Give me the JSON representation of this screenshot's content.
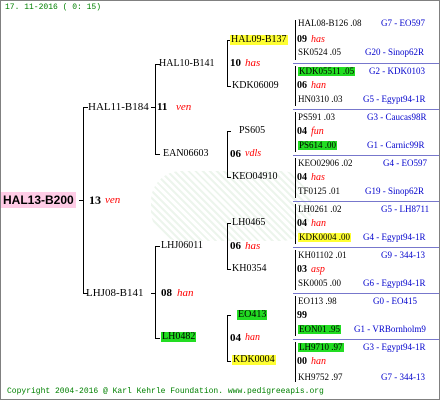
{
  "header": {
    "date": "17. 11-2016 (  0: 15)"
  },
  "footer": {
    "copyright": "Copyright 2004-2016 @ Karl Kehrle Foundation.   www.pedigreeapis.org"
  },
  "root": {
    "name": "HAL13-B200",
    "gen": "13",
    "breed": "ven"
  },
  "sire": {
    "name": "HAL11-B184",
    "gen": "11",
    "breed": "ven"
  },
  "dam": {
    "name": "LHJ08-B141",
    "gen": "08",
    "breed": "han"
  },
  "ss": {
    "name": "HAL10-B141",
    "gen": "10",
    "breed": "has"
  },
  "sd": {
    "name": "EAN06603",
    "gen": "06",
    "breed": "vdls"
  },
  "ds": {
    "name": "LHJ06011",
    "gen": "06",
    "breed": "has"
  },
  "dd": {
    "name": "LH0482",
    "gen": "04",
    "breed": "han"
  },
  "sss": {
    "name": "HAL09-B137",
    "gen": "09",
    "breed": "has"
  },
  "ssd": {
    "name": "KDK06009",
    "gen": "06",
    "breed": "han"
  },
  "sds": {
    "name": "PS605",
    "gen": "04",
    "breed": "fun"
  },
  "sdd": {
    "name": "KEO04910",
    "gen": "04",
    "breed": "has"
  },
  "dss": {
    "name": "LH0465",
    "gen": "04",
    "breed": "han"
  },
  "dsd": {
    "name": "KH0354",
    "gen": "03",
    "breed": "asp"
  },
  "dds": {
    "name": "EO413",
    "gen": "99",
    "breed": ""
  },
  "ddd": {
    "name": "KDK0004",
    "gen": "00",
    "breed": "han"
  },
  "leaves": [
    {
      "left": "HAL08-B126 .08",
      "right": "G7 - EO597"
    },
    {
      "left": "SK0524 .05",
      "right": "G20 - Sinop62R"
    },
    {
      "left": "KDK05511 .05",
      "right": "G2 - KDK0103"
    },
    {
      "left": "HN0310 .03",
      "right": "G5 - Egypt94-1R"
    },
    {
      "left": "PS591 .03",
      "right": "G3 - Caucas98R"
    },
    {
      "left": "PS614 .00",
      "right": "G1 - Carnic99R"
    },
    {
      "left": "KEO02906 .02",
      "right": "G4 - EO597"
    },
    {
      "left": "TF0125 .01",
      "right": "G19 - Sinop62R"
    },
    {
      "left": "LH0261 .02",
      "right": "G5 - LH8711"
    },
    {
      "left": "KDK0004 .00",
      "right": "G4 - Egypt94-1R"
    },
    {
      "left": "KH01102 .01",
      "right": "G9 - 344-13"
    },
    {
      "left": "SK0005 .00",
      "right": "G6 - Egypt94-1R"
    },
    {
      "left": "EO113 .98",
      "right": "G0 - EO415"
    },
    {
      "left": "EON01 .95",
      "right": "G1 - VRBornholm9"
    },
    {
      "left": "LH9710 .97",
      "right": "G3 - Egypt94-1R"
    },
    {
      "left": "KH9752 .97",
      "right": "G7 - 344-13"
    }
  ]
}
